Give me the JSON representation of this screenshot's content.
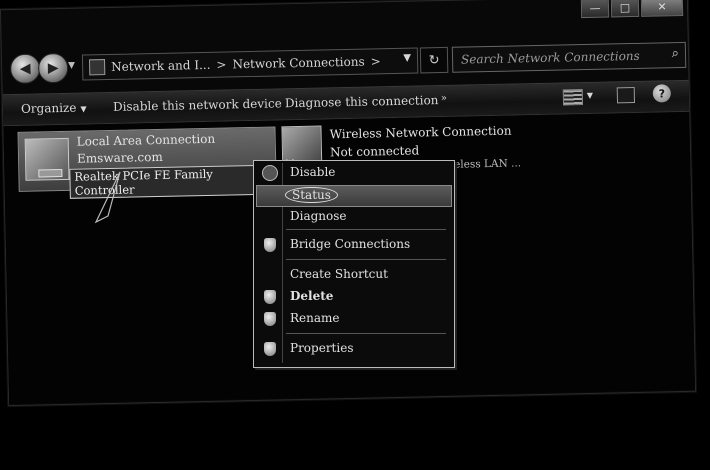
{
  "window": {
    "controls": {
      "minimize": "—",
      "maximize": "□",
      "close": "✕"
    }
  },
  "nav": {
    "back_icon": "◀",
    "forward_icon": "▶",
    "dropdown": "▼",
    "breadcrumb": [
      "Network and I...",
      "Network Connections"
    ],
    "separator": ">",
    "refresh_icon": "↻",
    "search_placeholder": "Search Network Connections",
    "search_icon": "⌕"
  },
  "toolbar": {
    "organize": "Organize",
    "organize_caret": "▼",
    "disable": "Disable this network device",
    "diagnose": "Diagnose this connection",
    "more": "»",
    "help": "?"
  },
  "connections": [
    {
      "name": "Local Area Connection",
      "status": "Emsware.com",
      "device": "Realtek PCIe FE Family Controller"
    },
    {
      "name": "Wireless Network Connection",
      "status": "Not connected",
      "device": "Belkin N150 Turbo Wireless LAN ..."
    }
  ],
  "context_menu": {
    "items": [
      {
        "label": "Disable",
        "icon": "disable-icon",
        "bold": false
      },
      {
        "label": "Status",
        "icon": "",
        "bold": false,
        "selected": true
      },
      {
        "label": "Diagnose",
        "icon": "",
        "bold": false
      },
      {
        "label": "Bridge Connections",
        "icon": "shield-icon",
        "bold": false
      },
      {
        "label": "Create Shortcut",
        "icon": "",
        "bold": false
      },
      {
        "label": "Delete",
        "icon": "shield-icon",
        "bold": true
      },
      {
        "label": "Rename",
        "icon": "shield-icon",
        "bold": false
      },
      {
        "label": "Properties",
        "icon": "shield-icon",
        "bold": false
      }
    ]
  },
  "colors": {
    "background": "#000000",
    "menu_border": "#bcbcbc",
    "selected": "#5c5c5c"
  }
}
